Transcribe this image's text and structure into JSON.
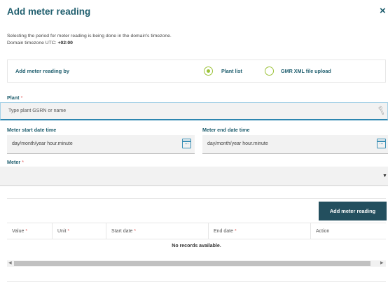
{
  "dialog": {
    "title": "Add meter reading",
    "close": "×",
    "info_line1": "Selecting the period for meter reading is being done in the domain's timezone.",
    "info_tz_prefix": "Domain timezone UTC: ",
    "info_tz_value": "+02:00"
  },
  "reading_by": {
    "label": "Add meter reading by",
    "options": [
      {
        "label": "Plant list",
        "selected": true
      },
      {
        "label": "GMR XML file upload",
        "selected": false
      }
    ]
  },
  "plant": {
    "label": "Plant",
    "required_mark": "*",
    "placeholder": "Type plant GSRN or name",
    "icon": "wrench-icon"
  },
  "meter_start": {
    "label": "Meter start date time",
    "placeholder": "day/month/year hour.minute",
    "icon": "calendar-icon"
  },
  "meter_end": {
    "label": "Meter end date time",
    "placeholder": "day/month/year hour.minute",
    "icon": "calendar-icon"
  },
  "meter": {
    "label": "Meter",
    "required_mark": "*",
    "value": "",
    "icon": "caret-down-icon"
  },
  "actions": {
    "add_label": "Add meter reading"
  },
  "table": {
    "columns": [
      {
        "label": "Value",
        "required": "*"
      },
      {
        "label": "Unit",
        "required": "*"
      },
      {
        "label": "Start date",
        "required": "*"
      },
      {
        "label": "End date",
        "required": "*"
      },
      {
        "label": "Action",
        "required": ""
      }
    ],
    "empty_text": "No records available."
  },
  "colors": {
    "title": "#1f5e6e",
    "accent_green": "#9cc23a",
    "button_bg": "#234f5e",
    "required": "#e05a5a",
    "focus_blue": "#2d86b0"
  }
}
